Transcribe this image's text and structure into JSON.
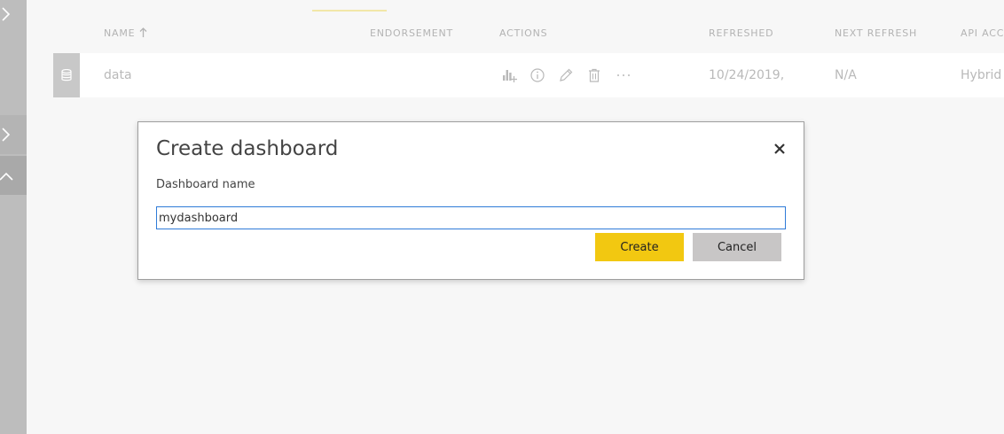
{
  "table": {
    "columns": {
      "name": "NAME",
      "endorsement": "ENDORSEMENT",
      "actions": "ACTIONS",
      "refreshed": "REFRESHED",
      "next_refresh": "NEXT REFRESH",
      "api_access": "API ACCE"
    },
    "rows": [
      {
        "icon": "database-icon",
        "name": "data",
        "refreshed": "10/24/2019,",
        "next_refresh": "N/A",
        "api_access": "Hybrid",
        "actions": [
          "create-report-icon",
          "info-icon",
          "pencil-icon",
          "trash-icon",
          "more-icon"
        ]
      }
    ]
  },
  "dialog": {
    "title": "Create dashboard",
    "name_label": "Dashboard name",
    "name_value": "mydashboard",
    "create_label": "Create",
    "cancel_label": "Cancel"
  },
  "colors": {
    "primary_button": "#f2c811",
    "secondary_button": "#c8c6c6",
    "input_focus_border": "#2f7bd8",
    "rail": "#bdbdbd"
  }
}
